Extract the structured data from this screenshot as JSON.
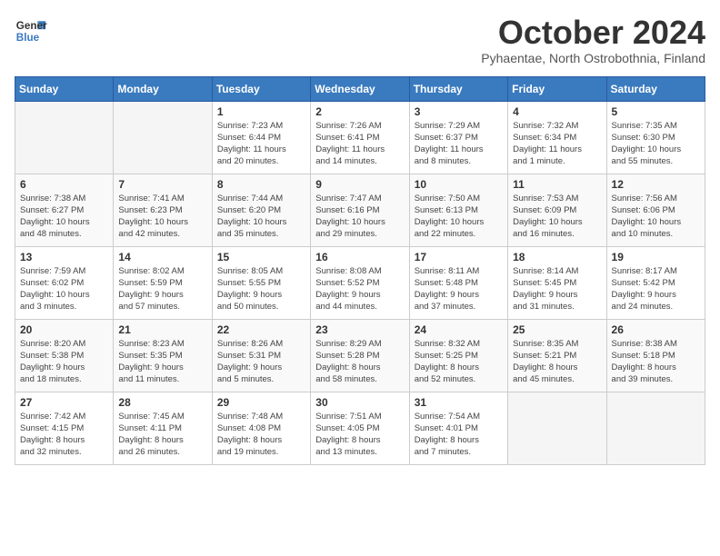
{
  "header": {
    "logo_line1": "General",
    "logo_line2": "Blue",
    "month": "October 2024",
    "location": "Pyhaentae, North Ostrobothnia, Finland"
  },
  "days_of_week": [
    "Sunday",
    "Monday",
    "Tuesday",
    "Wednesday",
    "Thursday",
    "Friday",
    "Saturday"
  ],
  "weeks": [
    [
      {
        "day": "",
        "info": ""
      },
      {
        "day": "",
        "info": ""
      },
      {
        "day": "1",
        "info": "Sunrise: 7:23 AM\nSunset: 6:44 PM\nDaylight: 11 hours\nand 20 minutes."
      },
      {
        "day": "2",
        "info": "Sunrise: 7:26 AM\nSunset: 6:41 PM\nDaylight: 11 hours\nand 14 minutes."
      },
      {
        "day": "3",
        "info": "Sunrise: 7:29 AM\nSunset: 6:37 PM\nDaylight: 11 hours\nand 8 minutes."
      },
      {
        "day": "4",
        "info": "Sunrise: 7:32 AM\nSunset: 6:34 PM\nDaylight: 11 hours\nand 1 minute."
      },
      {
        "day": "5",
        "info": "Sunrise: 7:35 AM\nSunset: 6:30 PM\nDaylight: 10 hours\nand 55 minutes."
      }
    ],
    [
      {
        "day": "6",
        "info": "Sunrise: 7:38 AM\nSunset: 6:27 PM\nDaylight: 10 hours\nand 48 minutes."
      },
      {
        "day": "7",
        "info": "Sunrise: 7:41 AM\nSunset: 6:23 PM\nDaylight: 10 hours\nand 42 minutes."
      },
      {
        "day": "8",
        "info": "Sunrise: 7:44 AM\nSunset: 6:20 PM\nDaylight: 10 hours\nand 35 minutes."
      },
      {
        "day": "9",
        "info": "Sunrise: 7:47 AM\nSunset: 6:16 PM\nDaylight: 10 hours\nand 29 minutes."
      },
      {
        "day": "10",
        "info": "Sunrise: 7:50 AM\nSunset: 6:13 PM\nDaylight: 10 hours\nand 22 minutes."
      },
      {
        "day": "11",
        "info": "Sunrise: 7:53 AM\nSunset: 6:09 PM\nDaylight: 10 hours\nand 16 minutes."
      },
      {
        "day": "12",
        "info": "Sunrise: 7:56 AM\nSunset: 6:06 PM\nDaylight: 10 hours\nand 10 minutes."
      }
    ],
    [
      {
        "day": "13",
        "info": "Sunrise: 7:59 AM\nSunset: 6:02 PM\nDaylight: 10 hours\nand 3 minutes."
      },
      {
        "day": "14",
        "info": "Sunrise: 8:02 AM\nSunset: 5:59 PM\nDaylight: 9 hours\nand 57 minutes."
      },
      {
        "day": "15",
        "info": "Sunrise: 8:05 AM\nSunset: 5:55 PM\nDaylight: 9 hours\nand 50 minutes."
      },
      {
        "day": "16",
        "info": "Sunrise: 8:08 AM\nSunset: 5:52 PM\nDaylight: 9 hours\nand 44 minutes."
      },
      {
        "day": "17",
        "info": "Sunrise: 8:11 AM\nSunset: 5:48 PM\nDaylight: 9 hours\nand 37 minutes."
      },
      {
        "day": "18",
        "info": "Sunrise: 8:14 AM\nSunset: 5:45 PM\nDaylight: 9 hours\nand 31 minutes."
      },
      {
        "day": "19",
        "info": "Sunrise: 8:17 AM\nSunset: 5:42 PM\nDaylight: 9 hours\nand 24 minutes."
      }
    ],
    [
      {
        "day": "20",
        "info": "Sunrise: 8:20 AM\nSunset: 5:38 PM\nDaylight: 9 hours\nand 18 minutes."
      },
      {
        "day": "21",
        "info": "Sunrise: 8:23 AM\nSunset: 5:35 PM\nDaylight: 9 hours\nand 11 minutes."
      },
      {
        "day": "22",
        "info": "Sunrise: 8:26 AM\nSunset: 5:31 PM\nDaylight: 9 hours\nand 5 minutes."
      },
      {
        "day": "23",
        "info": "Sunrise: 8:29 AM\nSunset: 5:28 PM\nDaylight: 8 hours\nand 58 minutes."
      },
      {
        "day": "24",
        "info": "Sunrise: 8:32 AM\nSunset: 5:25 PM\nDaylight: 8 hours\nand 52 minutes."
      },
      {
        "day": "25",
        "info": "Sunrise: 8:35 AM\nSunset: 5:21 PM\nDaylight: 8 hours\nand 45 minutes."
      },
      {
        "day": "26",
        "info": "Sunrise: 8:38 AM\nSunset: 5:18 PM\nDaylight: 8 hours\nand 39 minutes."
      }
    ],
    [
      {
        "day": "27",
        "info": "Sunrise: 7:42 AM\nSunset: 4:15 PM\nDaylight: 8 hours\nand 32 minutes."
      },
      {
        "day": "28",
        "info": "Sunrise: 7:45 AM\nSunset: 4:11 PM\nDaylight: 8 hours\nand 26 minutes."
      },
      {
        "day": "29",
        "info": "Sunrise: 7:48 AM\nSunset: 4:08 PM\nDaylight: 8 hours\nand 19 minutes."
      },
      {
        "day": "30",
        "info": "Sunrise: 7:51 AM\nSunset: 4:05 PM\nDaylight: 8 hours\nand 13 minutes."
      },
      {
        "day": "31",
        "info": "Sunrise: 7:54 AM\nSunset: 4:01 PM\nDaylight: 8 hours\nand 7 minutes."
      },
      {
        "day": "",
        "info": ""
      },
      {
        "day": "",
        "info": ""
      }
    ]
  ]
}
